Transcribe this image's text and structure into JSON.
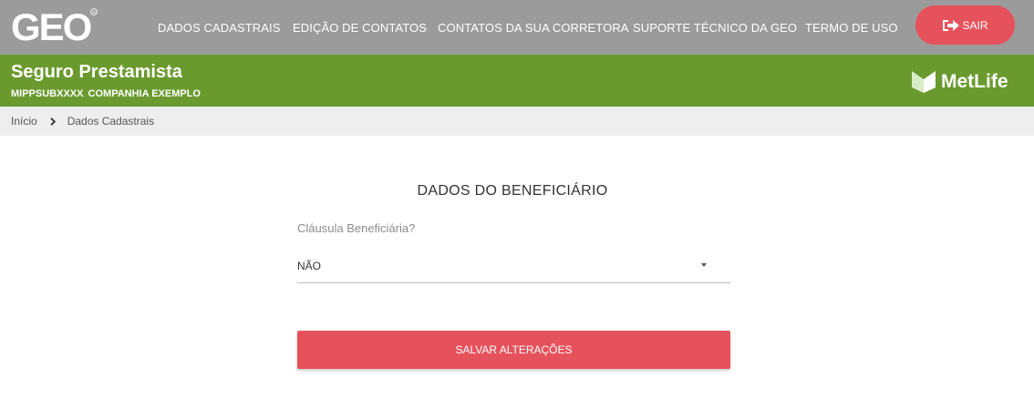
{
  "header": {
    "logo_text": "GEO",
    "nav_items": [
      "DADOS CADASTRAIS",
      "EDIÇÃO DE CONTATOS",
      "CONTATOS DA SUA CORRETORA",
      "SUPORTE TÉCNICO DA GEO",
      "TERMO DE USO"
    ],
    "logout_label": "SAIR",
    "logout_icon": "sign-out-icon"
  },
  "banner": {
    "product": "Seguro Prestamista",
    "policy_code": "MIPPSUBXXXX",
    "company": "COMPANHIA EXEMPLO",
    "partner_name": "MetLife"
  },
  "breadcrumb": {
    "items": [
      "Início",
      "Dados Cadastrais"
    ]
  },
  "form": {
    "title": "DADOS DO BENEFICIÁRIO",
    "field_label": "Cláusula Beneficiária?",
    "selected_value": "NÃO",
    "save_label": "SALVAR ALTERAÇÕES"
  },
  "colors": {
    "header_bg": "#9b9b9b",
    "banner_bg": "#6a9a2e",
    "accent": "#e5525c",
    "breadcrumb_bg": "#eeeeee"
  }
}
